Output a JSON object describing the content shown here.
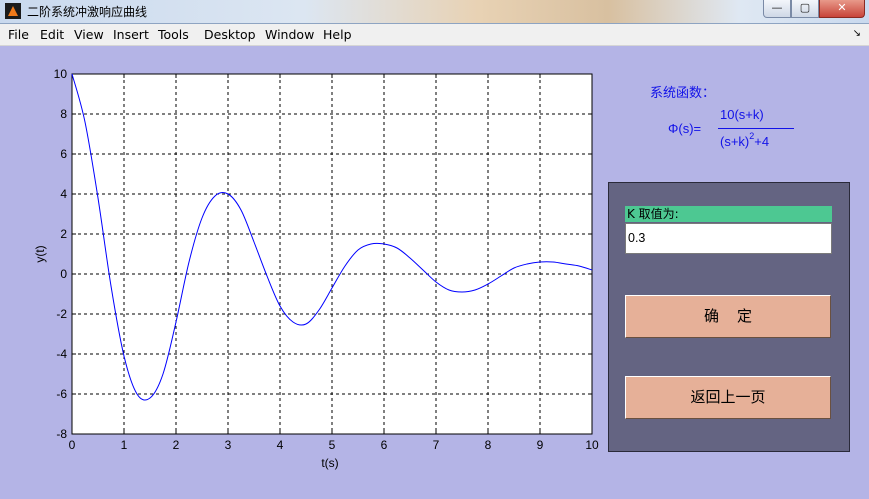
{
  "window": {
    "title": "二阶系统冲激响应曲线",
    "min_label": "—",
    "max_label": "▢",
    "close_label": "✕"
  },
  "menu": {
    "items": [
      "File",
      "Edit",
      "View",
      "Insert",
      "Tools",
      "Desktop",
      "Window",
      "Help"
    ],
    "dock_label": "↘"
  },
  "formula": {
    "label": "系统函数：",
    "lhs": "Φ(s)=",
    "numerator": "10(s+k)",
    "denominator_base": "(s+k)",
    "denominator_exp": "2",
    "denominator_tail": "+4"
  },
  "controls": {
    "k_label": "K 取值为:",
    "k_value": "0.3",
    "ok_label": "确定",
    "back_label": "返回上一页"
  },
  "colors": {
    "curve": "#0000ff",
    "text_blue": "#1212e8",
    "figure_bg": "#b4b4e6",
    "panel_bg": "#646482",
    "label_green": "#4dc892",
    "button": "#e6b098"
  },
  "chart_data": {
    "type": "line",
    "xlabel": "t(s)",
    "ylabel": "y(t)",
    "xlim": [
      0,
      10
    ],
    "ylim": [
      -8,
      10
    ],
    "xticks": [
      0,
      1,
      2,
      3,
      4,
      5,
      6,
      7,
      8,
      9,
      10
    ],
    "yticks": [
      -8,
      -6,
      -4,
      -2,
      0,
      2,
      4,
      6,
      8,
      10
    ],
    "grid": true,
    "x": [
      0,
      0.25,
      0.5,
      0.75,
      1.0,
      1.25,
      1.5,
      1.75,
      2.0,
      2.25,
      2.5,
      2.75,
      3.0,
      3.25,
      3.5,
      3.75,
      4.0,
      4.25,
      4.5,
      4.75,
      5.0,
      5.25,
      5.5,
      5.75,
      6.0,
      6.25,
      6.5,
      6.75,
      7.0,
      7.25,
      7.5,
      7.75,
      8.0,
      8.25,
      8.5,
      8.75,
      9.0,
      9.25,
      9.5,
      9.75,
      10.0
    ],
    "y": [
      10.0,
      7.6,
      3.8,
      -0.6,
      -4.1,
      -6.0,
      -6.2,
      -5.0,
      -2.4,
      0.6,
      2.8,
      3.9,
      4.0,
      3.2,
      1.6,
      -0.1,
      -1.6,
      -2.4,
      -2.5,
      -1.8,
      -0.7,
      0.4,
      1.2,
      1.5,
      1.5,
      1.3,
      0.8,
      0.2,
      -0.4,
      -0.8,
      -0.9,
      -0.8,
      -0.5,
      -0.1,
      0.3,
      0.5,
      0.6,
      0.6,
      0.5,
      0.4,
      0.2
    ]
  }
}
